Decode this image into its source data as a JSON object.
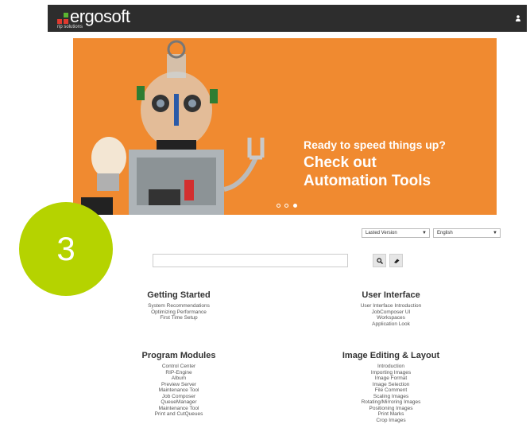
{
  "header": {
    "logo_text": "ergosoft",
    "logo_subtext": "rip solutions",
    "colors": {
      "bar": "#2d2d2d",
      "logo_red": "#e03a2f",
      "logo_green": "#5bb531"
    }
  },
  "banner": {
    "line1": "Ready to speed things up?",
    "line2": "Check out",
    "line3": "Automation Tools",
    "background": "#f08a30",
    "slides": 3,
    "active_slide": 3
  },
  "step_badge": {
    "text": "3",
    "color": "#b5d300"
  },
  "filters": {
    "version": "Lasted Version",
    "language": "English"
  },
  "search": {
    "value": ""
  },
  "sections": [
    {
      "title": "Getting Started",
      "links": [
        "System Recommendations",
        "Optimizing Performance",
        "First Time Setup"
      ]
    },
    {
      "title": "User Interface",
      "links": [
        "User Interface Introduction",
        "JobComposer UI",
        "Workspaces",
        "Application Look"
      ]
    },
    {
      "title": "Program Modules",
      "links": [
        "Control Center",
        "RIP-Engine",
        "Album",
        "Preview Server",
        "Maintenance Tool",
        "Job Composer",
        "QueueManager",
        "Maintenance Tool",
        "Print and CutQueues"
      ]
    },
    {
      "title": "Image Editing & Layout",
      "links": [
        "Introduction",
        "Importing Images",
        "Image Format",
        "Image Selection",
        "File Comment",
        "Scaling Images",
        "Rotating/Mirroring Images",
        "Positioning Images",
        "Print Marks",
        "Crop Images"
      ]
    }
  ]
}
